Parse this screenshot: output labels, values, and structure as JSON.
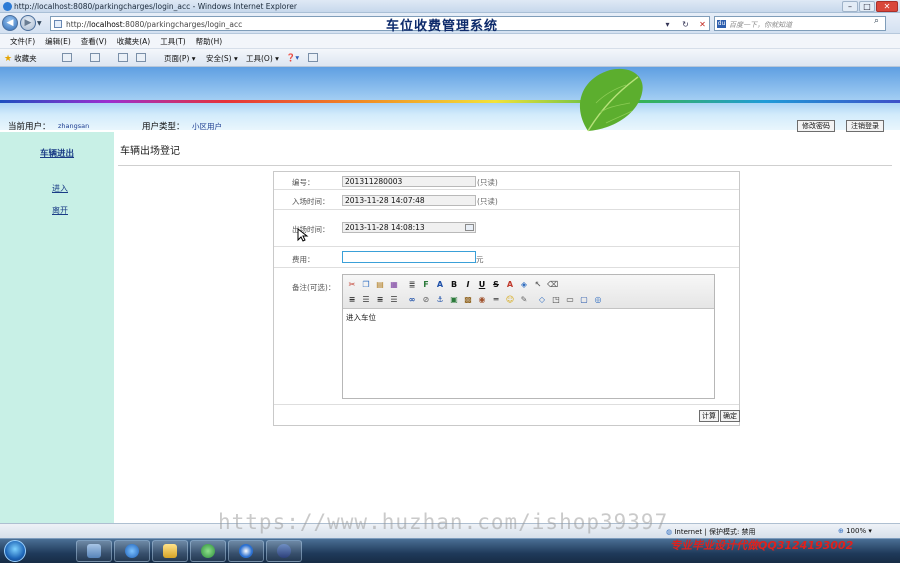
{
  "browser": {
    "window_title": "http://localhost:8080/parkingcharges/login_acc - Windows Internet Explorer",
    "address_prefix": "http://",
    "address_host": "localhost",
    "address_rest": ":8080/parkingcharges/login_acc",
    "search_placeholder": "百度一下，你就知道",
    "menu": [
      "文件(F)",
      "编辑(E)",
      "查看(V)",
      "收藏夹(A)",
      "工具(T)",
      "帮助(H)"
    ],
    "favorites_label": "收藏夹",
    "cmd": {
      "page": "页面(P) ▾",
      "safety": "安全(S) ▾",
      "tools": "工具(O) ▾"
    },
    "status_zone": "Internet | 保护模式: 禁用",
    "zoom": "100%"
  },
  "header": {
    "system_title": "车位收费管理系统",
    "current_user_label": "当前用户：",
    "current_user": "zhangsan",
    "user_type_label": "用户类型：",
    "user_type": "小区用户",
    "change_password": "修改密码",
    "logout": "注销登录"
  },
  "sidebar": {
    "title": "车辆进出",
    "items": [
      "进入",
      "离开"
    ]
  },
  "page": {
    "title": "车辆出场登记"
  },
  "form": {
    "id_label": "编号：",
    "id_value": "201311280003",
    "id_note": "(只读)",
    "entry_time_label": "入场时间：",
    "entry_time_value": "2013-11-28 14:07:48",
    "entry_time_note": "(只读)",
    "exit_time_label": "出场时间：",
    "exit_time_value": "2013-11-28 14:08:13",
    "fee_label": "费用：",
    "fee_value": "",
    "fee_unit": "元",
    "remark_label": "备注(可选)：",
    "remark_text": "进入车位",
    "calc_button": "计算",
    "confirm_button": "确定"
  },
  "overlay": {
    "watermark": "https://www.huzhan.com/ishop39397",
    "promo": "专业毕业设计代做QQ3124193002"
  }
}
